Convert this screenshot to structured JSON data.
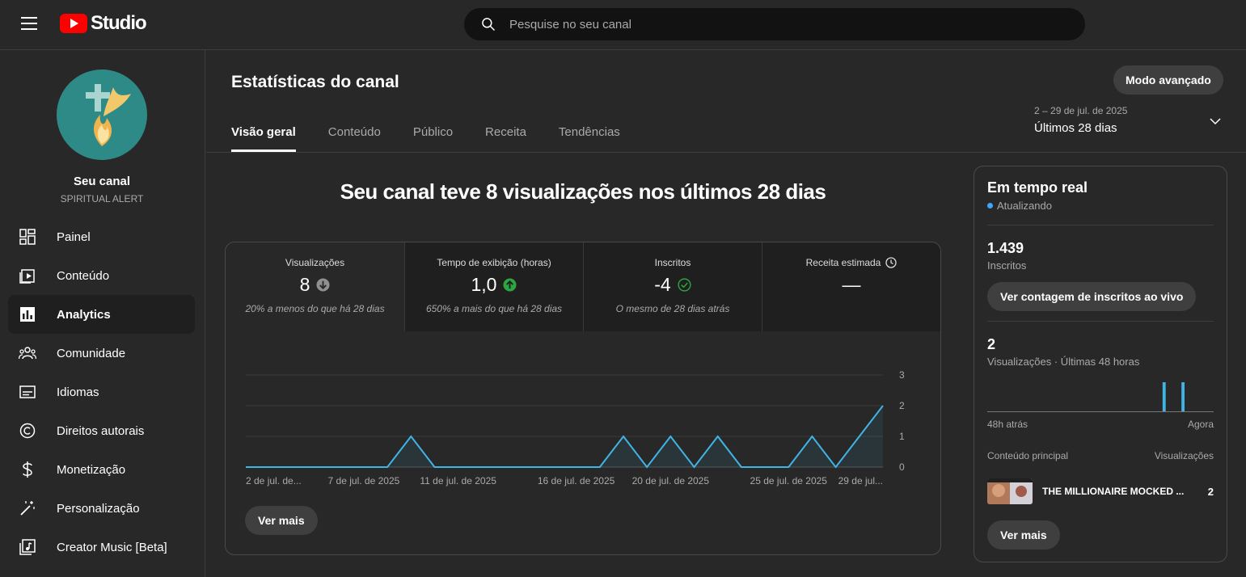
{
  "app": {
    "logo_text": "Studio"
  },
  "search": {
    "placeholder": "Pesquise no seu canal"
  },
  "channel": {
    "name": "Seu canal",
    "handle": "SPIRITUAL ALERT"
  },
  "sidebar": {
    "items": [
      {
        "label": "Painel",
        "icon": "dashboard-icon"
      },
      {
        "label": "Conteúdo",
        "icon": "content-icon"
      },
      {
        "label": "Analytics",
        "icon": "analytics-icon",
        "active": true
      },
      {
        "label": "Comunidade",
        "icon": "community-icon"
      },
      {
        "label": "Idiomas",
        "icon": "subtitles-icon"
      },
      {
        "label": "Direitos autorais",
        "icon": "copyright-icon"
      },
      {
        "label": "Monetização",
        "icon": "dollar-icon"
      },
      {
        "label": "Personalização",
        "icon": "magic-wand-icon"
      },
      {
        "label": "Creator Music [Beta]",
        "icon": "music-icon"
      }
    ]
  },
  "header": {
    "title": "Estatísticas do canal",
    "advanced_button": "Modo avançado",
    "tabs": [
      "Visão geral",
      "Conteúdo",
      "Público",
      "Receita",
      "Tendências"
    ],
    "date_range": "2 – 29 de jul. de 2025",
    "date_label": "Últimos 28 dias"
  },
  "overview": {
    "headline": "Seu canal teve 8 visualizações nos últimos 28 dias",
    "metrics": [
      {
        "label": "Visualizações",
        "value": "8",
        "note": "20% a menos do que há 28 dias",
        "trend": "down"
      },
      {
        "label": "Tempo de exibição (horas)",
        "value": "1,0",
        "note": "650% a mais do que há 28 dias",
        "trend": "up"
      },
      {
        "label": "Inscritos",
        "value": "-4",
        "note": "O mesmo de 28 dias atrás",
        "trend": "same"
      },
      {
        "label": "Receita estimada",
        "value": "—",
        "note": "",
        "trend": "clock"
      }
    ],
    "see_more": "Ver mais"
  },
  "chart_data": {
    "type": "area",
    "title": "",
    "xlabel": "",
    "ylabel": "",
    "ylim": [
      0,
      3
    ],
    "yticks": [
      0,
      1,
      2,
      3
    ],
    "x_labels": [
      {
        "day": 2,
        "label": "2 de jul. de..."
      },
      {
        "day": 7,
        "label": "7 de jul. de 2025"
      },
      {
        "day": 11,
        "label": "11 de jul. de 2025"
      },
      {
        "day": 16,
        "label": "16 de jul. de 2025"
      },
      {
        "day": 20,
        "label": "20 de jul. de 2025"
      },
      {
        "day": 25,
        "label": "25 de jul. de 2025"
      },
      {
        "day": 29,
        "label": "29 de jul..."
      }
    ],
    "x": [
      2,
      3,
      3.5,
      4,
      5,
      6,
      7,
      8,
      9,
      10,
      11,
      12,
      13,
      14,
      15,
      16,
      17,
      18,
      19,
      20,
      21,
      22,
      23,
      24,
      25,
      26,
      27,
      28,
      29
    ],
    "values": [
      0,
      0,
      0,
      0,
      0,
      0,
      0,
      0,
      1,
      0,
      0,
      0,
      0,
      0,
      0,
      0,
      0,
      1,
      0,
      1,
      0,
      1,
      0,
      0,
      0,
      1,
      0,
      1,
      2
    ],
    "color": "#41b4e6",
    "grid": true
  },
  "realtime": {
    "title": "Em tempo real",
    "status": "Atualizando",
    "subscribers_value": "1.439",
    "subscribers_label": "Inscritos",
    "live_count_button": "Ver contagem de inscritos ao vivo",
    "views_value": "2",
    "views_label": "Visualizações · Últimas 48 horas",
    "axis_left": "48h atrás",
    "axis_right": "Agora",
    "col_left": "Conteúdo principal",
    "col_right": "Visualizações",
    "top_video": {
      "title": "THE MILLIONAIRE MOCKED ...",
      "views": "2"
    },
    "see_more": "Ver mais",
    "bars": {
      "hours": 48,
      "values_at": [
        {
          "hour_index": 37,
          "value": 1
        },
        {
          "hour_index": 41,
          "value": 1
        }
      ]
    }
  }
}
